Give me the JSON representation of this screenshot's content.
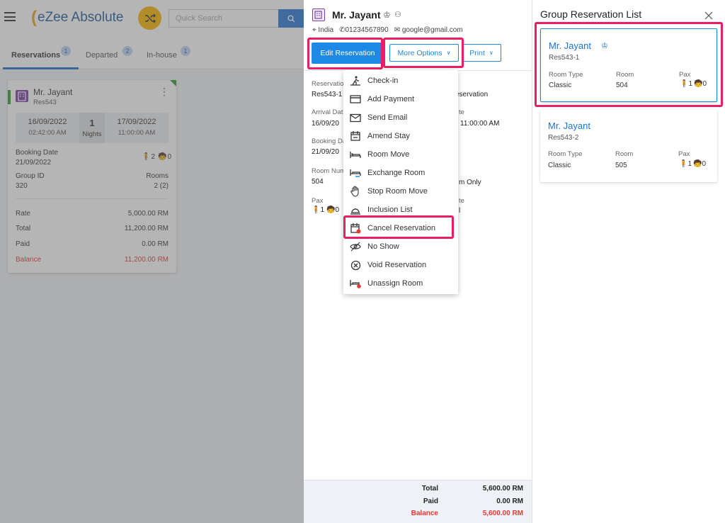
{
  "app": {
    "logo": "eZee Absolute",
    "search_placeholder": "Quick Search"
  },
  "tabs": [
    {
      "label": "Reservations",
      "count": "1"
    },
    {
      "label": "Departed",
      "count": "2"
    },
    {
      "label": "In-house",
      "count": "1"
    }
  ],
  "card": {
    "guest": "Mr. Jayant",
    "res_no": "Res543",
    "arrival_date": "16/09/2022",
    "arrival_time": "02:42:00 AM",
    "nights_num": "1",
    "nights_label": "Nights",
    "departure_date": "17/09/2022",
    "departure_time": "11:00:00 AM",
    "booking_date_label": "Booking Date",
    "booking_date": "21/09/2022",
    "pax_adult": "2",
    "pax_child": "0",
    "group_label": "Group ID",
    "group_id": "320",
    "rooms_label": "Rooms",
    "rooms": "2 (2)",
    "rate_label": "Rate",
    "rate": "5,000.00 RM",
    "total_label": "Total",
    "total": "11,200.00 RM",
    "paid_label": "Paid",
    "paid": "0.00 RM",
    "balance_label": "Balance",
    "balance": "11,200.00 RM"
  },
  "detail": {
    "guest": "Mr. Jayant",
    "country": "India",
    "phone": "01234567890",
    "email": "google@gmail.com",
    "edit_btn": "Edit Reservation",
    "more_btn": "More Options",
    "print_btn": "Print",
    "fields": [
      {
        "label": "Reservation",
        "value": "Res543-1"
      },
      {
        "label": "Arrival Dat",
        "value": "16/09/20"
      },
      {
        "label": "Booking Da",
        "value": "21/09/20"
      },
      {
        "label": "Room Num",
        "value": "504"
      },
      {
        "label": "Pax",
        "value": ""
      }
    ],
    "right_bits": [
      "eservation",
      "te",
      "11:00:00 AM",
      "m Only",
      "te",
      "l"
    ],
    "pax_adult": "1",
    "pax_child": "0",
    "footer": {
      "total_label": "Total",
      "total": "5,600.00 RM",
      "paid_label": "Paid",
      "paid": "0.00 RM",
      "balance_label": "Balance",
      "balance": "5,600.00 RM"
    }
  },
  "menu": [
    {
      "label": "Check-in",
      "icon": "checkin-icon"
    },
    {
      "label": "Add Payment",
      "icon": "card-icon"
    },
    {
      "label": "Send Email",
      "icon": "mail-icon"
    },
    {
      "label": "Amend Stay",
      "icon": "calendar-icon"
    },
    {
      "label": "Room Move",
      "icon": "bed-icon"
    },
    {
      "label": "Exchange Room",
      "icon": "exchange-bed-icon"
    },
    {
      "label": "Stop Room Move",
      "icon": "hand-icon"
    },
    {
      "label": "Inclusion List",
      "icon": "tray-icon"
    },
    {
      "label": "Cancel Reservation",
      "icon": "calendar-cancel-icon"
    },
    {
      "label": "No Show",
      "icon": "eye-off-icon"
    },
    {
      "label": "Void Reservation",
      "icon": "x-circle-icon"
    },
    {
      "label": "Unassign Room",
      "icon": "bed-cancel-icon"
    }
  ],
  "group": {
    "title": "Group Reservation List",
    "col_room_type": "Room Type",
    "col_room": "Room",
    "col_pax": "Pax",
    "items": [
      {
        "name": "Mr. Jayant",
        "res": "Res543-1",
        "room_type": "Classic",
        "room": "504",
        "adult": "1",
        "child": "0"
      },
      {
        "name": "Mr. Jayant",
        "res": "Res543-2",
        "room_type": "Classic",
        "room": "505",
        "adult": "1",
        "child": "0"
      }
    ]
  },
  "colors": {
    "primary": "#1a73d1",
    "accent": "#e91e63",
    "danger": "#e53935",
    "brand_yellow": "#f7b500"
  }
}
